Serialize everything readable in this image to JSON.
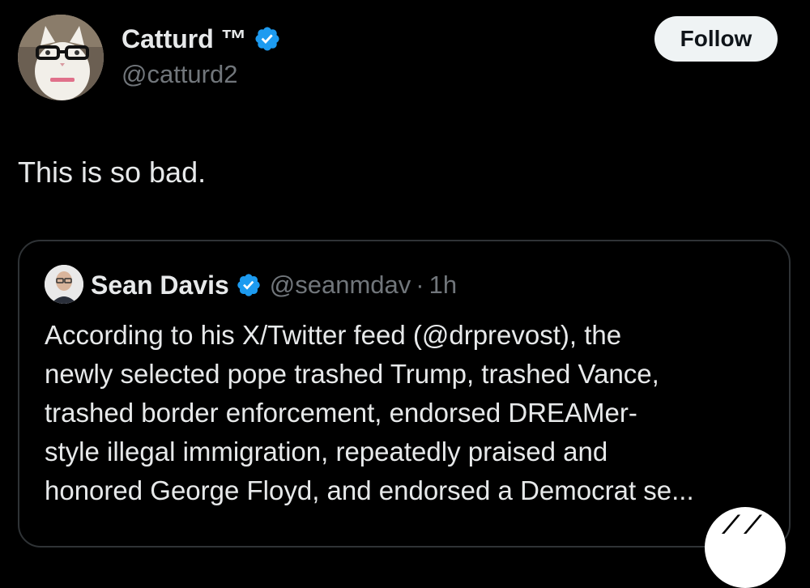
{
  "tweet": {
    "author": {
      "display_name": "Catturd ™",
      "handle": "@catturd2"
    },
    "follow_label": "Follow",
    "text": "This is so bad."
  },
  "quote": {
    "author": {
      "display_name": "Sean Davis",
      "handle": "@seanmdav",
      "separator": "·",
      "time": "1h"
    },
    "text_lines": [
      "According to his X/Twitter feed (@drprevost), the",
      "newly selected pope trashed Trump, trashed Vance,",
      "trashed border enforcement, endorsed DREAMer-",
      "style illegal immigration, repeatedly praised and",
      "honored George Floyd, and endorsed a Democrat se..."
    ]
  },
  "colors": {
    "background": "#000000",
    "text_primary": "#e7e9ea",
    "text_secondary": "#71767b",
    "verified_blue": "#1d9bf0",
    "follow_button_bg": "#eff3f4",
    "card_border": "#2f3336"
  },
  "icons": {
    "verified": "verified-badge-icon",
    "corner": "grok-fab-icon"
  }
}
